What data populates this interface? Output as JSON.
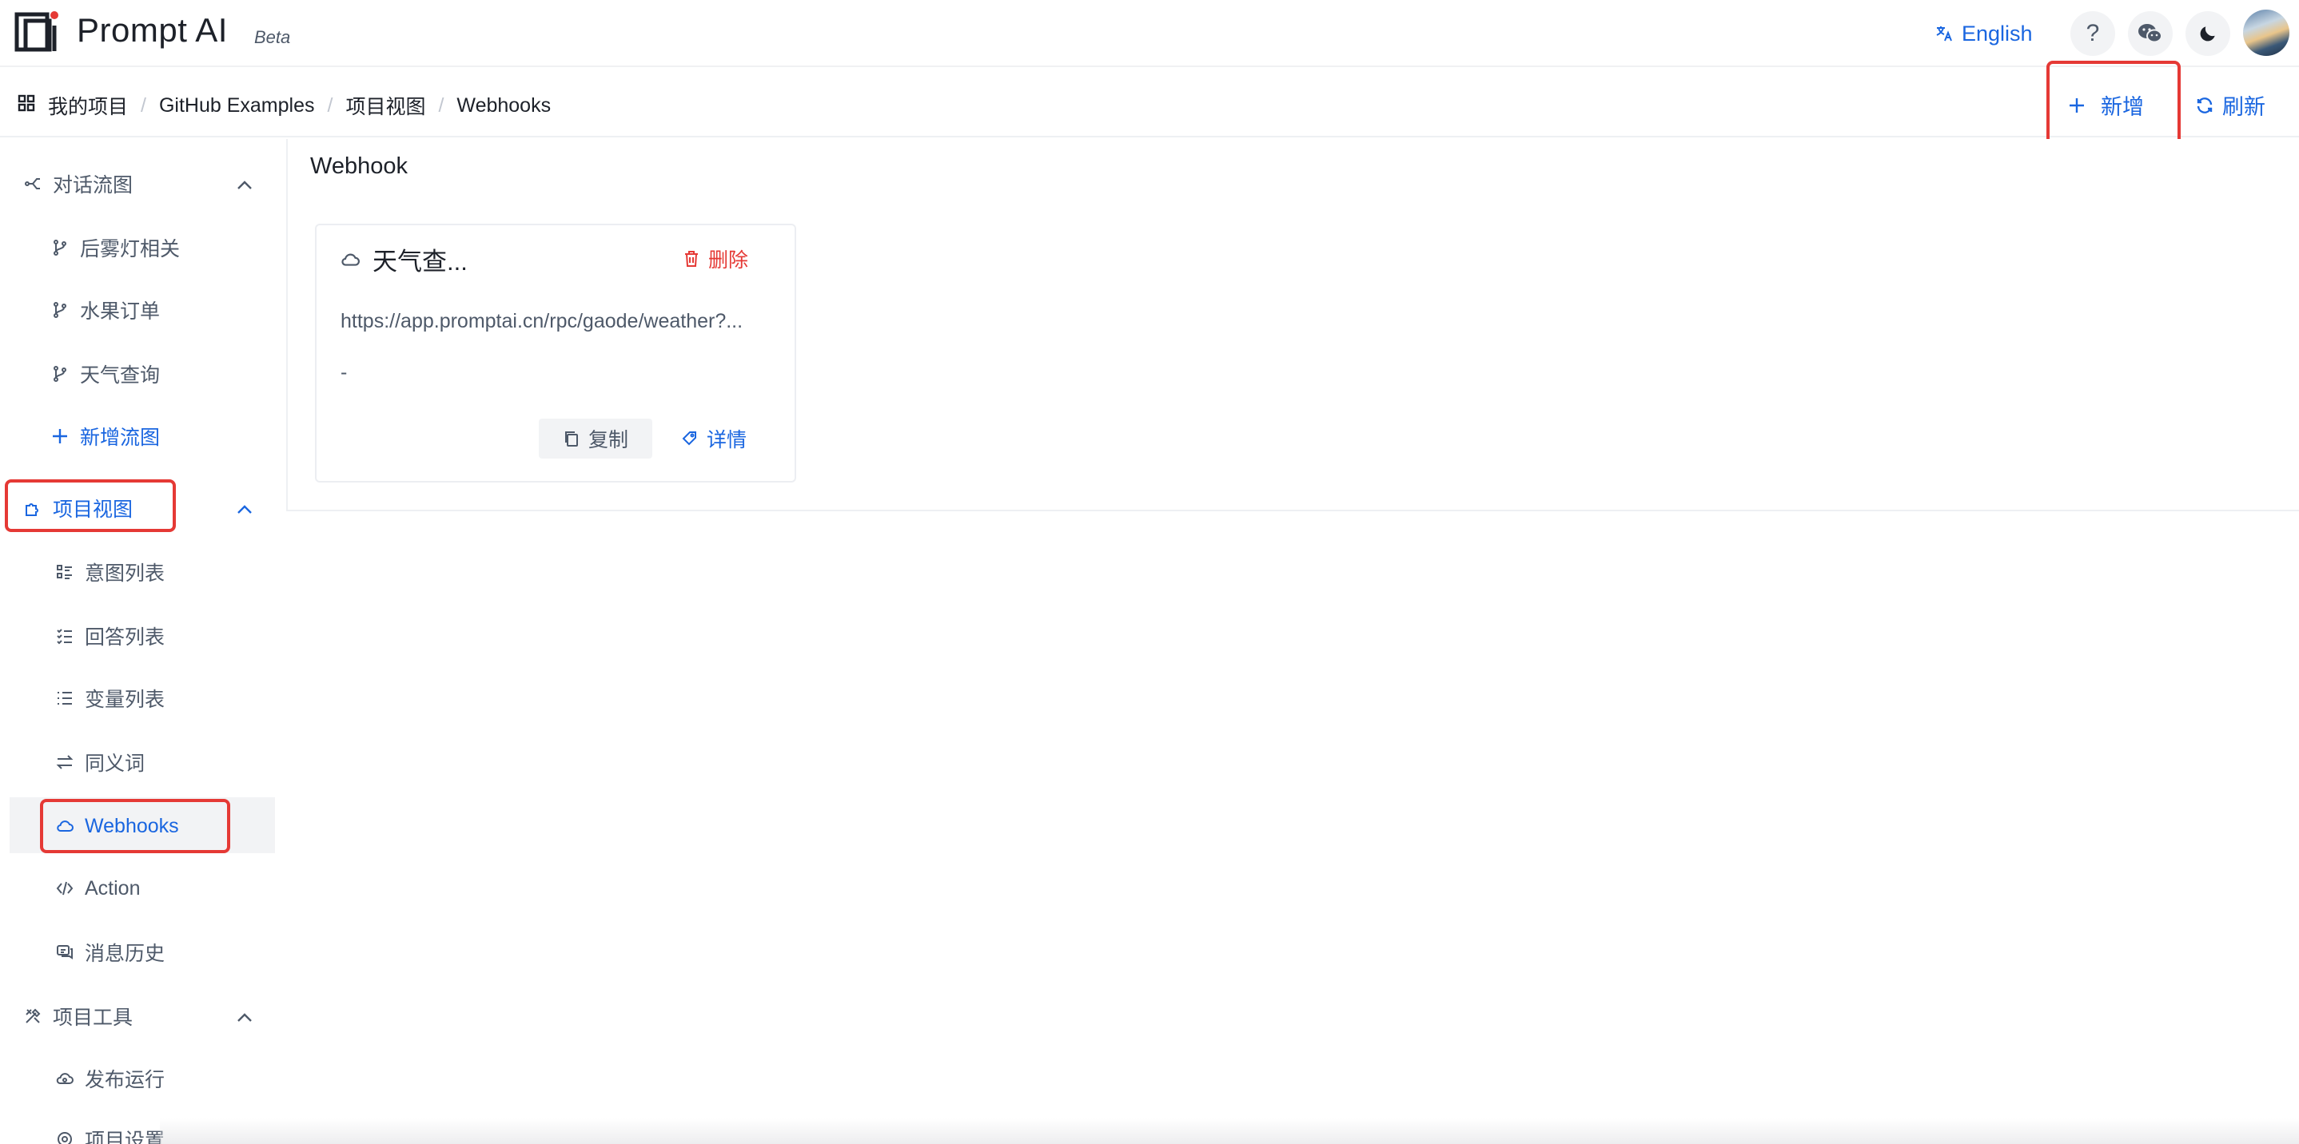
{
  "app": {
    "name": "Prompt AI",
    "badge": "Beta"
  },
  "header": {
    "language_label": "English",
    "help_label": "?"
  },
  "breadcrumb": [
    "我的项目",
    "GitHub Examples",
    "项目视图",
    "Webhooks"
  ],
  "toolbar": {
    "add_label": "新增",
    "refresh_label": "刷新"
  },
  "sidebar": {
    "groups": [
      {
        "label": "对话流图",
        "expanded": true,
        "items": [
          {
            "label": "后雾灯相关"
          },
          {
            "label": "水果订单"
          },
          {
            "label": "天气查询"
          },
          {
            "label": "新增流图"
          }
        ]
      },
      {
        "label": "项目视图",
        "expanded": true,
        "items": [
          {
            "label": "意图列表"
          },
          {
            "label": "回答列表"
          },
          {
            "label": "变量列表"
          },
          {
            "label": "同义词"
          },
          {
            "label": "Webhooks",
            "active": true
          },
          {
            "label": "Action"
          },
          {
            "label": "消息历史"
          }
        ]
      },
      {
        "label": "项目工具",
        "expanded": true,
        "items": [
          {
            "label": "发布运行"
          },
          {
            "label": "项目设置"
          }
        ]
      }
    ]
  },
  "main": {
    "title": "Webhook",
    "cards": [
      {
        "name": "天气查...",
        "delete_label": "删除",
        "url": "https://app.promptai.cn/rpc/gaode/weather?...",
        "description": "-",
        "copy_label": "复制",
        "detail_label": "详情"
      }
    ]
  },
  "colors": {
    "accent": "#1a66e0",
    "danger": "#e53935",
    "highlight": "#e53935"
  }
}
